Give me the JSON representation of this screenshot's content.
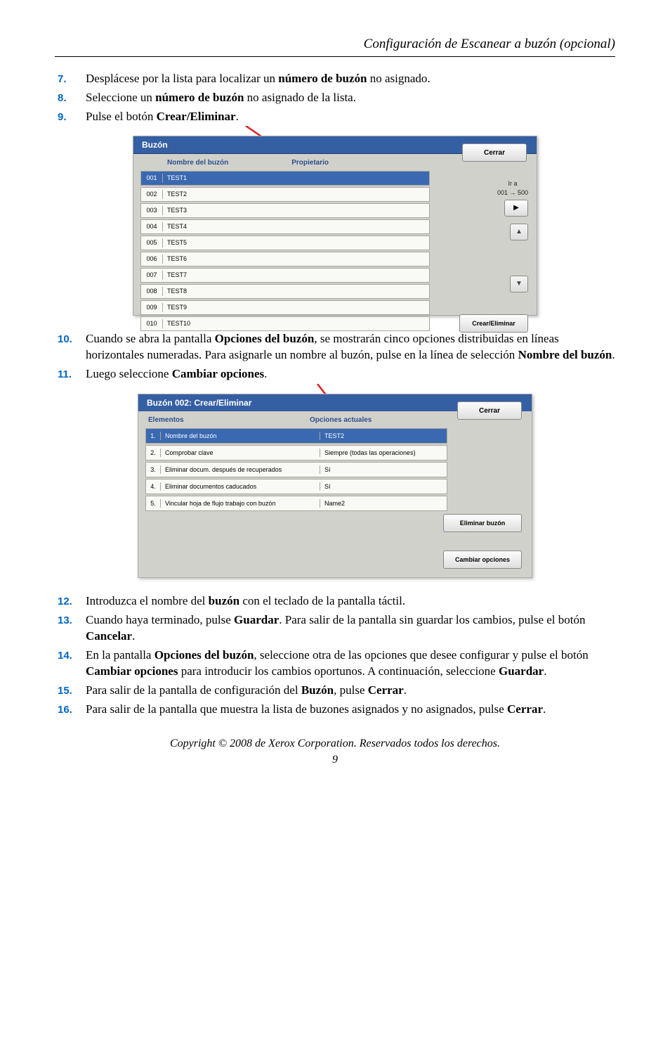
{
  "header": {
    "section_title": "Configuración de Escanear a buzón (opcional)"
  },
  "steps": [
    {
      "n": "7.",
      "html": "Desplácese por la lista para localizar un <b>número de buzón</b> no asignado."
    },
    {
      "n": "8.",
      "html": "Seleccione un <b>número de buzón</b> no asignado de la lista."
    },
    {
      "n": "9.",
      "html": "Pulse el botón <b>Crear/Eliminar</b>."
    }
  ],
  "fig1": {
    "title": "Buzón",
    "close": "Cerrar",
    "col1": "Nombre del buzón",
    "col2": "Propietario",
    "goto_line1": "Ir a",
    "goto_line2": "001 → 500",
    "create_btn": "Crear/Eliminar",
    "rows": [
      {
        "idx": "001",
        "name": "TEST1",
        "selected": true
      },
      {
        "idx": "002",
        "name": "TEST2",
        "selected": false
      },
      {
        "idx": "003",
        "name": "TEST3",
        "selected": false
      },
      {
        "idx": "004",
        "name": "TEST4",
        "selected": false
      },
      {
        "idx": "005",
        "name": "TEST5",
        "selected": false
      },
      {
        "idx": "006",
        "name": "TEST6",
        "selected": false
      },
      {
        "idx": "007",
        "name": "TEST7",
        "selected": false
      },
      {
        "idx": "008",
        "name": "TEST8",
        "selected": false
      },
      {
        "idx": "009",
        "name": "TEST9",
        "selected": false
      },
      {
        "idx": "010",
        "name": "TEST10",
        "selected": false
      }
    ]
  },
  "steps2": [
    {
      "n": "10.",
      "html": "Cuando se abra la pantalla <b>Opciones del buzón</b>, se mostrarán cinco opciones distribuidas en líneas horizontales numeradas. Para asignarle un nombre al buzón, pulse en la línea de selección <b>Nombre del buzón</b>."
    },
    {
      "n": "11.",
      "html": "Luego seleccione <b>Cambiar opciones</b>."
    }
  ],
  "fig2": {
    "title": "Buzón 002: Crear/Eliminar",
    "close": "Cerrar",
    "col1": "Elementos",
    "col2": "Opciones actuales",
    "delete_btn": "Eliminar buzón",
    "change_btn": "Cambiar opciones",
    "rows": [
      {
        "n": "1.",
        "label": "Nombre del buzón",
        "val": "TEST2",
        "selected": true
      },
      {
        "n": "2.",
        "label": "Comprobar clave",
        "val": "Siempre (todas las operaciones)",
        "selected": false
      },
      {
        "n": "3.",
        "label": "Eliminar docum. después de recuperados",
        "val": "Sí",
        "selected": false
      },
      {
        "n": "4.",
        "label": "Eliminar documentos caducados",
        "val": "Sí",
        "selected": false
      },
      {
        "n": "5.",
        "label": "Vincular hoja de flujo trabajo con buzón",
        "val": "Name2",
        "selected": false
      }
    ]
  },
  "steps3": [
    {
      "n": "12.",
      "html": "Introduzca el nombre del <b>buzón</b> con el teclado de la pantalla táctil."
    },
    {
      "n": "13.",
      "html": "Cuando haya terminado, pulse <b>Guardar</b>. Para salir de la pantalla sin guardar los cambios, pulse el botón <b>Cancelar</b>."
    },
    {
      "n": "14.",
      "html": "En la pantalla <b>Opciones del buzón</b>, seleccione otra de las opciones que desee configurar y pulse el botón <b>Cambiar opciones</b> para introducir los cambios oportunos. A continuación, seleccione <b>Guardar</b>."
    },
    {
      "n": "15.",
      "html": "Para salir de la pantalla de configuración del <b>Buzón</b>, pulse <b>Cerrar</b>."
    },
    {
      "n": "16.",
      "html": "Para salir de la pantalla que muestra la lista de buzones asignados y no asignados, pulse <b>Cerrar</b>."
    }
  ],
  "footer": {
    "copyright": "Copyright © 2008 de Xerox Corporation. Reservados todos los derechos.",
    "page": "9"
  }
}
